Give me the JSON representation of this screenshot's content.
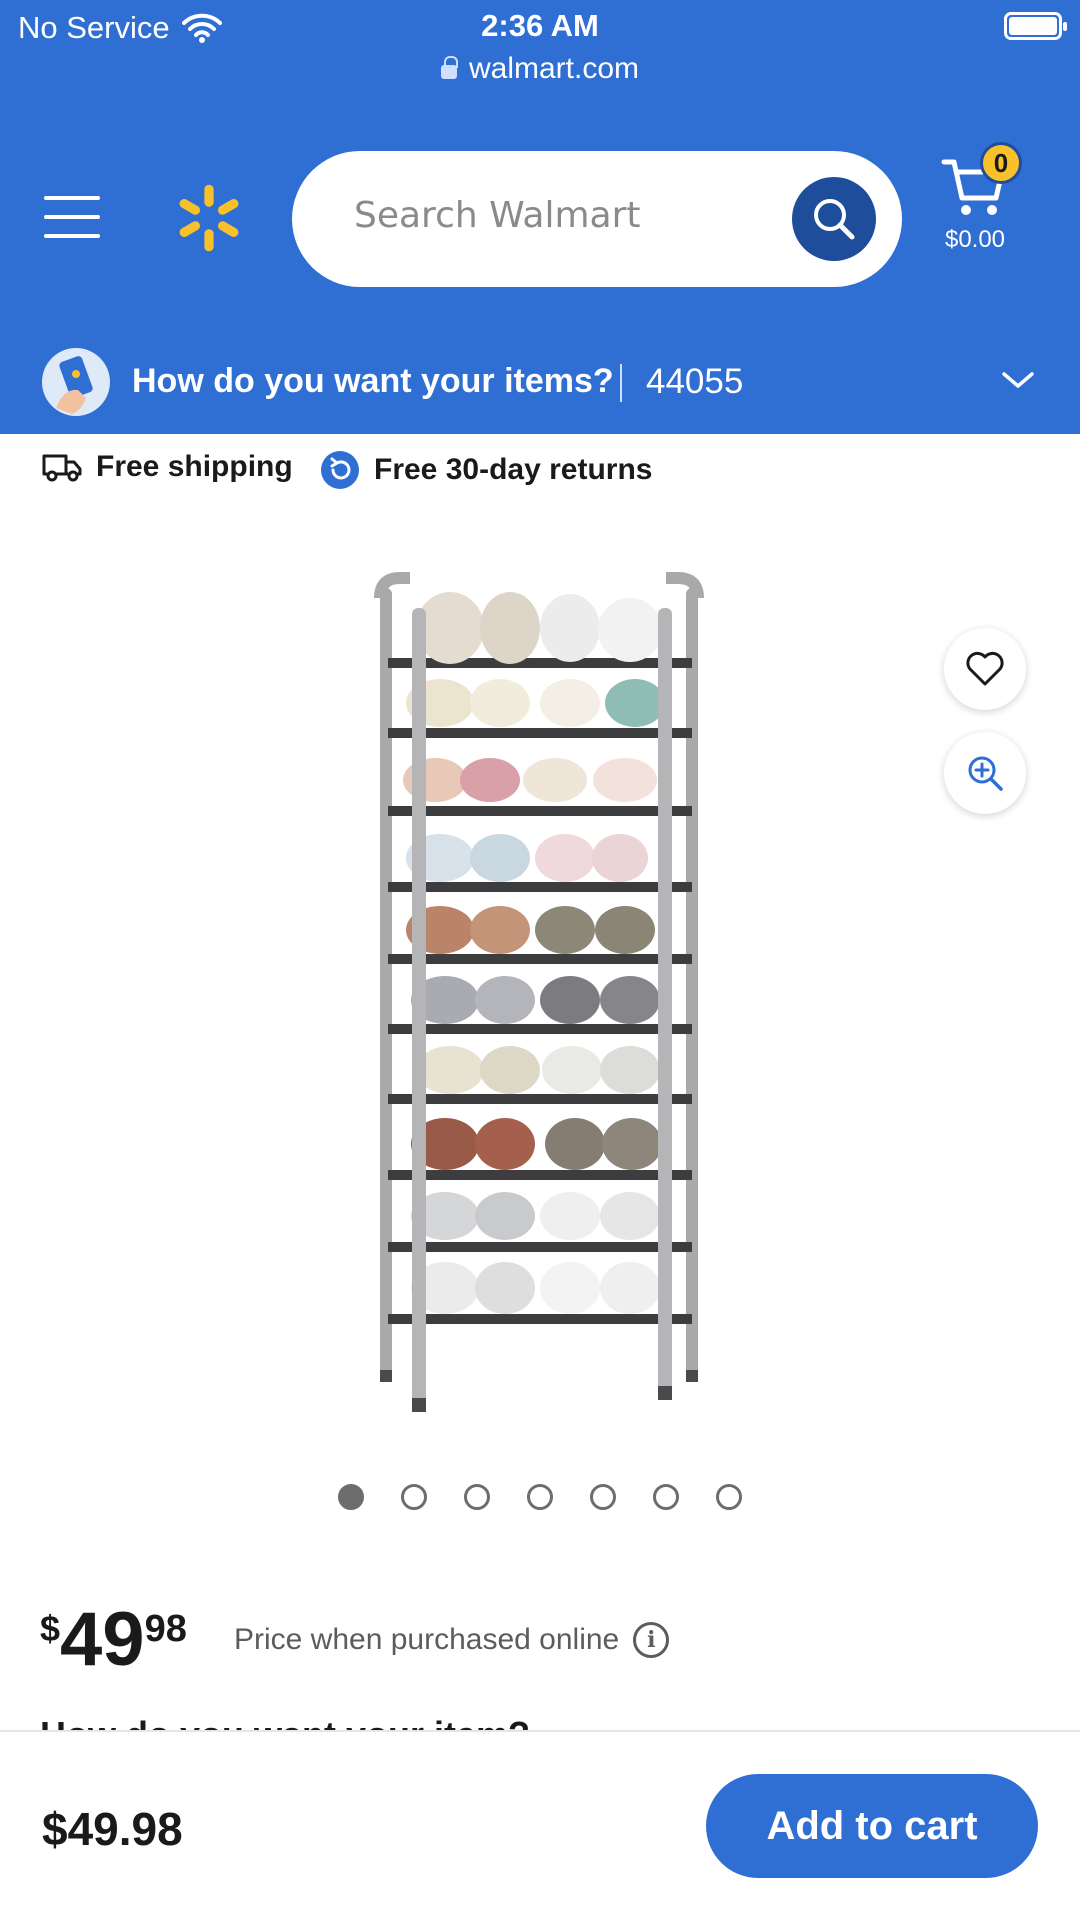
{
  "status_bar": {
    "carrier": "No Service",
    "time": "2:36 AM",
    "url": "walmart.com"
  },
  "header": {
    "search_placeholder": "Search Walmart",
    "cart_count": "0",
    "cart_total": "$0.00"
  },
  "delivery": {
    "prompt": "How do you want your items?",
    "zip": "44055"
  },
  "perks": {
    "shipping": "Free shipping",
    "returns": "Free 30-day returns"
  },
  "gallery": {
    "image_count": 7,
    "active_index": 0
  },
  "price": {
    "currency": "$",
    "whole": "49",
    "cents": "98",
    "note": "Price when purchased online",
    "info_symbol": "i"
  },
  "section_heading_partial": "How do you want your item?",
  "bottom_bar": {
    "price": "$49.98",
    "add_to_cart_label": "Add to cart"
  },
  "colors": {
    "brand_blue": "#2f6fd4",
    "dark_blue": "#1e4d9c",
    "spark_yellow": "#f8c02b"
  },
  "icons": [
    "wifi-icon",
    "lock-icon",
    "battery-icon",
    "menu-icon",
    "walmart-spark-logo",
    "search-icon",
    "cart-icon",
    "chevron-down-icon",
    "truck-icon",
    "returns-icon",
    "heart-icon",
    "zoom-in-icon",
    "info-icon"
  ]
}
